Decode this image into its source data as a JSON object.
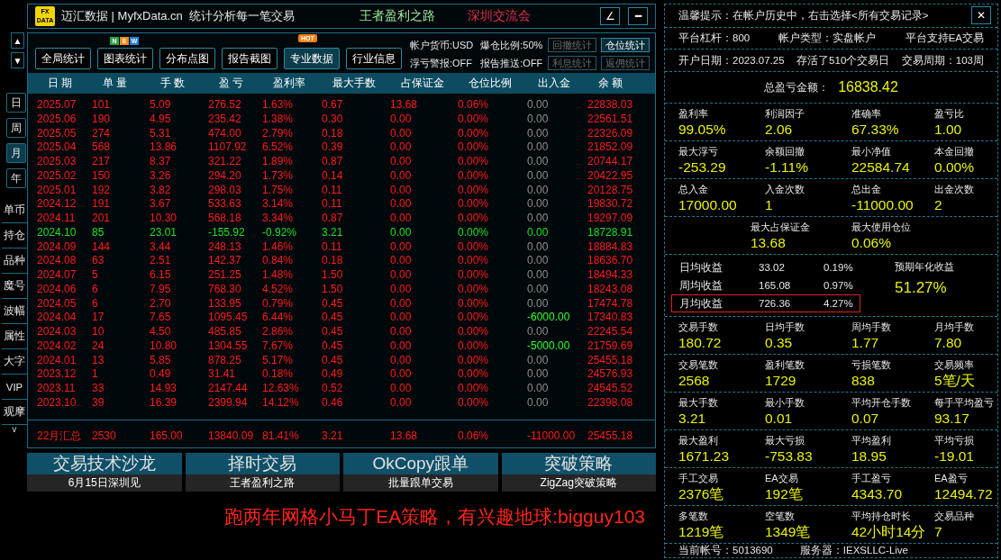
{
  "title_bar": {
    "logo": "FX DATA",
    "app_name": "迈汇数据 | MyfxData.cn",
    "tagline": "统计分析每一笔交易",
    "link_1": "王者盈利之路",
    "link_2": "深圳交流会",
    "window_buttons": [
      "∠",
      "━"
    ]
  },
  "sidebar": {
    "arrows": [
      "▲",
      "▼"
    ],
    "periods": [
      {
        "label": "日",
        "selected": false
      },
      {
        "label": "周",
        "selected": false
      },
      {
        "label": "月",
        "selected": true
      },
      {
        "label": "年",
        "selected": false
      }
    ],
    "items": [
      "单币",
      "持仓",
      "品种",
      "魔号",
      "波幅",
      "属性",
      "大字",
      "VIP",
      "观摩"
    ],
    "more": "˅"
  },
  "toolbar": {
    "buttons": [
      {
        "label": "全局统计",
        "selected": false
      },
      {
        "label": "图表统计",
        "selected": false,
        "badge": {
          "kind": "letters",
          "letters": [
            {
              "text": "N",
              "color": "#2aa84a"
            },
            {
              "text": "E",
              "color": "#f08a10"
            },
            {
              "text": "W",
              "color": "#1e7fe0"
            }
          ]
        }
      },
      {
        "label": "分布点图",
        "selected": false
      },
      {
        "label": "报告截图",
        "selected": false
      },
      {
        "label": "专业数据",
        "selected": true,
        "badge": {
          "kind": "bubble",
          "text": "HOT"
        }
      },
      {
        "label": "行业信息",
        "selected": false
      }
    ],
    "info": [
      "帐户货币:USD",
      "爆仓比例:50%",
      "浮亏警报:OFF",
      "报告推送:OFF"
    ],
    "stat_buttons": [
      {
        "label": "回撤统计",
        "selected": false
      },
      {
        "label": "仓位统计",
        "selected": true
      },
      {
        "label": "利息统计",
        "selected": false
      },
      {
        "label": "返佣统计",
        "selected": false
      }
    ]
  },
  "table": {
    "columns": [
      "日 期",
      "单 量",
      "手 数",
      "盈 亏",
      "盈利率",
      "最大手数",
      "占保证金",
      "仓位比例",
      "出入金",
      "余 额"
    ],
    "rows": [
      {
        "cells": [
          "2025.07",
          "101",
          "5.09",
          "276.52",
          "1.63%",
          "0.67",
          "13.68",
          "0.06%",
          "0.00",
          "22838.03"
        ],
        "loss": false,
        "withdrawal": false
      },
      {
        "cells": [
          "2025.06",
          "190",
          "4.95",
          "235.42",
          "1.38%",
          "0.30",
          "0.00",
          "0.00%",
          "0.00",
          "22561.51"
        ],
        "loss": false,
        "withdrawal": false
      },
      {
        "cells": [
          "2025.05",
          "274",
          "5.31",
          "474.00",
          "2.79%",
          "0.18",
          "0.00",
          "0.00%",
          "0.00",
          "22326.09"
        ],
        "loss": false,
        "withdrawal": false
      },
      {
        "cells": [
          "2025.04",
          "568",
          "13.86",
          "1107.92",
          "6.52%",
          "0.39",
          "0.00",
          "0.00%",
          "0.00",
          "21852.09"
        ],
        "loss": false,
        "withdrawal": false
      },
      {
        "cells": [
          "2025.03",
          "217",
          "8.37",
          "321.22",
          "1.89%",
          "0.87",
          "0.00",
          "0.00%",
          "0.00",
          "20744.17"
        ],
        "loss": false,
        "withdrawal": false
      },
      {
        "cells": [
          "2025.02",
          "150",
          "3.26",
          "294.20",
          "1.73%",
          "0.14",
          "0.00",
          "0.00%",
          "0.00",
          "20422.95"
        ],
        "loss": false,
        "withdrawal": false
      },
      {
        "cells": [
          "2025.01",
          "192",
          "3.82",
          "298.03",
          "1.75%",
          "0.11",
          "0.00",
          "0.00%",
          "0.00",
          "20128.75"
        ],
        "loss": false,
        "withdrawal": false
      },
      {
        "cells": [
          "2024.12",
          "191",
          "3.67",
          "533.63",
          "3.14%",
          "0.11",
          "0.00",
          "0.00%",
          "0.00",
          "19830.72"
        ],
        "loss": false,
        "withdrawal": false
      },
      {
        "cells": [
          "2024.11",
          "201",
          "10.30",
          "568.18",
          "3.34%",
          "0.87",
          "0.00",
          "0.00%",
          "0.00",
          "19297.09"
        ],
        "loss": false,
        "withdrawal": false
      },
      {
        "cells": [
          "2024.10",
          "85",
          "23.01",
          "-155.92",
          "-0.92%",
          "3.21",
          "0.00",
          "0.00%",
          "0.00",
          "18728.91"
        ],
        "loss": true,
        "withdrawal": false
      },
      {
        "cells": [
          "2024.09",
          "144",
          "3.44",
          "248.13",
          "1.46%",
          "0.11",
          "0.00",
          "0.00%",
          "0.00",
          "18884.83"
        ],
        "loss": false,
        "withdrawal": false
      },
      {
        "cells": [
          "2024.08",
          "63",
          "2.51",
          "142.37",
          "0.84%",
          "0.18",
          "0.00",
          "0.00%",
          "0.00",
          "18636.70"
        ],
        "loss": false,
        "withdrawal": false
      },
      {
        "cells": [
          "2024.07",
          "5",
          "6.15",
          "251.25",
          "1.48%",
          "1.50",
          "0.00",
          "0.00%",
          "0.00",
          "18494.33"
        ],
        "loss": false,
        "withdrawal": false
      },
      {
        "cells": [
          "2024.06",
          "6",
          "7.95",
          "768.30",
          "4.52%",
          "1.50",
          "0.00",
          "0.00%",
          "0.00",
          "18243.08"
        ],
        "loss": false,
        "withdrawal": false
      },
      {
        "cells": [
          "2024.05",
          "6",
          "2.70",
          "133.95",
          "0.79%",
          "0.45",
          "0.00",
          "0.00%",
          "0.00",
          "17474.78"
        ],
        "loss": false,
        "withdrawal": false
      },
      {
        "cells": [
          "2024.04",
          "17",
          "7.65",
          "1095.45",
          "6.44%",
          "0.45",
          "0.00",
          "0.00%",
          "-6000.00",
          "17340.83"
        ],
        "loss": false,
        "withdrawal": true
      },
      {
        "cells": [
          "2024.03",
          "10",
          "4.50",
          "485.85",
          "2.86%",
          "0.45",
          "0.00",
          "0.00%",
          "0.00",
          "22245.54"
        ],
        "loss": false,
        "withdrawal": false
      },
      {
        "cells": [
          "2024.02",
          "24",
          "10.80",
          "1304.55",
          "7.67%",
          "0.45",
          "0.00",
          "0.00%",
          "-5000.00",
          "21759.69"
        ],
        "loss": false,
        "withdrawal": true
      },
      {
        "cells": [
          "2024.01",
          "13",
          "5.85",
          "878.25",
          "5.17%",
          "0.45",
          "0.00",
          "0.00%",
          "0.00",
          "25455.18"
        ],
        "loss": false,
        "withdrawal": false
      },
      {
        "cells": [
          "2023.12",
          "1",
          "0.49",
          "31.41",
          "0.18%",
          "0.49",
          "0.00",
          "0.00%",
          "0.00",
          "24576.93"
        ],
        "loss": false,
        "withdrawal": false
      },
      {
        "cells": [
          "2023.11",
          "33",
          "14.93",
          "2147.44",
          "12.63%",
          "0.52",
          "0.00",
          "0.00%",
          "0.00",
          "24545.52"
        ],
        "loss": false,
        "withdrawal": false
      },
      {
        "cells": [
          "2023.10",
          "39",
          "16.39",
          "2399.94",
          "14.12%",
          "0.46",
          "0.00",
          "0.00%",
          "0.00",
          "22398.08"
        ],
        "loss": false,
        "withdrawal": false
      }
    ],
    "summary": [
      "22月汇总",
      "2530",
      "165.00",
      "13840.09",
      "81.41%",
      "3.21",
      "13.68",
      "0.06%",
      "-11000.00",
      "25455.18"
    ]
  },
  "promos": [
    {
      "title": "交易技术沙龙",
      "subtitle": "6月15日深圳见"
    },
    {
      "title": "择时交易",
      "subtitle": "王者盈利之路"
    },
    {
      "title": "OkCopy跟单",
      "subtitle": "批量跟单交易"
    },
    {
      "title": "突破策略",
      "subtitle": "ZigZag突破策略"
    }
  ],
  "banner": "跑两年网格小马丁EA策略，有兴趣地球:bigguy103",
  "panel": {
    "tip": "温馨提示：在帐户历史中，右击选择<所有交易记录>",
    "close": "✕",
    "info_rows": [
      [
        "平台杠杆：800",
        "帐户类型：实盘帐户",
        "平台支持EA交易"
      ],
      [
        "开户日期：2023.07.25",
        "存活了510个交易日",
        "交易周期：103周"
      ]
    ],
    "total": {
      "label": "总盈亏金额：",
      "value": "16838.42"
    },
    "groups": [
      {
        "kind": "grid",
        "stats": [
          {
            "label": "盈利率",
            "value": "99.05%"
          },
          {
            "label": "利润因子",
            "value": "2.06"
          },
          {
            "label": "准确率",
            "value": "67.33%"
          },
          {
            "label": "盈亏比",
            "value": "1.00"
          }
        ]
      },
      {
        "kind": "grid",
        "stats": [
          {
            "label": "最大浮亏",
            "value": "-253.29"
          },
          {
            "label": "余额回撤",
            "value": "-1.11%"
          },
          {
            "label": "最小净值",
            "value": "22584.74"
          },
          {
            "label": "本金回撤",
            "value": "0.00%"
          }
        ]
      },
      {
        "kind": "grid",
        "stats": [
          {
            "label": "总入金",
            "value": "17000.00"
          },
          {
            "label": "入金次数",
            "value": "1"
          },
          {
            "label": "总出金",
            "value": "-11000.00"
          },
          {
            "label": "出金次数",
            "value": "2"
          }
        ]
      },
      {
        "kind": "pair",
        "stats": [
          {
            "label": "最大占保证金",
            "value": "13.68"
          },
          {
            "label": "最大使用仓位",
            "value": "0.06%"
          }
        ]
      },
      {
        "kind": "averages",
        "rows": [
          {
            "label": "日均收益",
            "amount": "33.02",
            "percent": "0.19%",
            "highlighted": false
          },
          {
            "label": "周均收益",
            "amount": "165.08",
            "percent": "0.97%",
            "highlighted": false
          },
          {
            "label": "月均收益",
            "amount": "726.36",
            "percent": "4.27%",
            "highlighted": true
          }
        ],
        "forecast": {
          "label": "预期年化收益",
          "value": "51.27%"
        }
      },
      {
        "kind": "grid",
        "stats": [
          {
            "label": "交易手数",
            "value": "180.72"
          },
          {
            "label": "日均手数",
            "value": "0.35"
          },
          {
            "label": "周均手数",
            "value": "1.77"
          },
          {
            "label": "月均手数",
            "value": "7.80"
          }
        ]
      },
      {
        "kind": "grid",
        "stats": [
          {
            "label": "交易笔数",
            "value": "2568"
          },
          {
            "label": "盈利笔数",
            "value": "1729"
          },
          {
            "label": "亏损笔数",
            "value": "838"
          },
          {
            "label": "交易频率",
            "value": "5笔/天"
          }
        ]
      },
      {
        "kind": "grid",
        "stats": [
          {
            "label": "最大手数",
            "value": "3.21"
          },
          {
            "label": "最小手数",
            "value": "0.01"
          },
          {
            "label": "平均开仓手数",
            "value": "0.07"
          },
          {
            "label": "每手平均盈亏",
            "value": "93.17"
          }
        ]
      },
      {
        "kind": "grid",
        "stats": [
          {
            "label": "最大盈利",
            "value": "1671.23"
          },
          {
            "label": "最大亏损",
            "value": "-753.83"
          },
          {
            "label": "平均盈利",
            "value": "18.95"
          },
          {
            "label": "平均亏损",
            "value": "-19.01"
          }
        ]
      },
      {
        "kind": "grid",
        "stats": [
          {
            "label": "手工交易",
            "value": "2376笔"
          },
          {
            "label": "EA交易",
            "value": "192笔"
          },
          {
            "label": "手工盈亏",
            "value": "4343.70"
          },
          {
            "label": "EA盈亏",
            "value": "12494.72"
          }
        ]
      },
      {
        "kind": "grid",
        "stats": [
          {
            "label": "多笔数",
            "value": "1219笔"
          },
          {
            "label": "空笔数",
            "value": "1349笔"
          },
          {
            "label": "平均持仓时长",
            "value": "42小时14分"
          },
          {
            "label": "交易品种",
            "value": "7"
          }
        ]
      }
    ],
    "footer": [
      "当前帐号：5013690",
      "服务器：IEXSLLC-Live"
    ]
  }
}
